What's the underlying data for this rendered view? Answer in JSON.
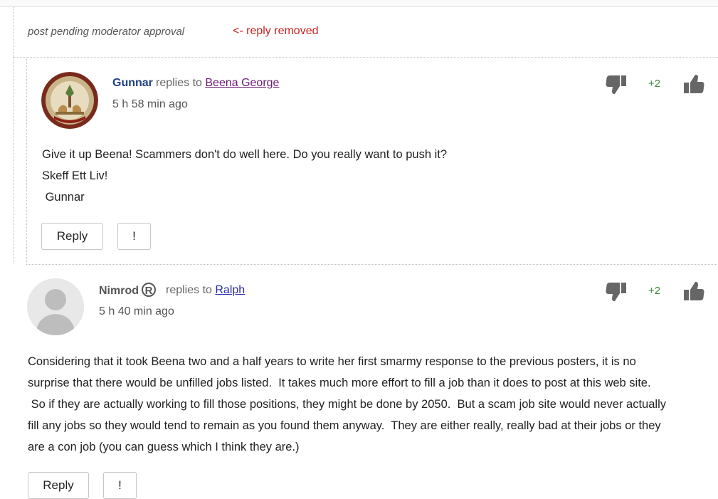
{
  "pending": {
    "text": "post pending moderator approval",
    "note": "<- reply removed"
  },
  "comments": [
    {
      "author": "Gunnar",
      "replies_prefix": "replies to",
      "reply_to": "Beena George",
      "time": "5 h 58 min ago",
      "score": "+2",
      "lines": [
        "Give it up Beena! Scammers don't do well here. Do you really want to push it?",
        "Skeff Ett Liv!",
        " Gunnar"
      ],
      "reply_label": "Reply",
      "flag_label": "!"
    },
    {
      "author": "Nimrod",
      "badge": "R",
      "replies_prefix": "replies to",
      "reply_to": "Ralph",
      "time": "5 h 40 min ago",
      "score": "+2",
      "lines": [
        "Considering that it took Beena two and a half years to write her first smarmy response to the previous posters, it is no",
        "surprise that there would be unfilled jobs listed.  It takes much more effort to fill a job than it does to post at this web site.",
        " So if they are actually working to fill those positions, they might be done by 2050.  But a scam job site would never actually",
        "fill any jobs so they would tend to remain as you found them anyway.  They are either really, really bad at their jobs or they",
        "are a con job (you can guess which I think they are.)"
      ],
      "reply_label": "Reply",
      "flag_label": "!"
    }
  ],
  "icons": {
    "thumb_down": "thumbs-down-icon",
    "thumb_up": "thumbs-up-icon",
    "avatar_default": "default-avatar-icon"
  },
  "colors": {
    "author_blue": "#1d3f86",
    "removed_red": "#cc1f1f",
    "score_green": "#3a8a3a",
    "link_purple": "#6a1b73",
    "link_blue": "#2a2ab0"
  }
}
